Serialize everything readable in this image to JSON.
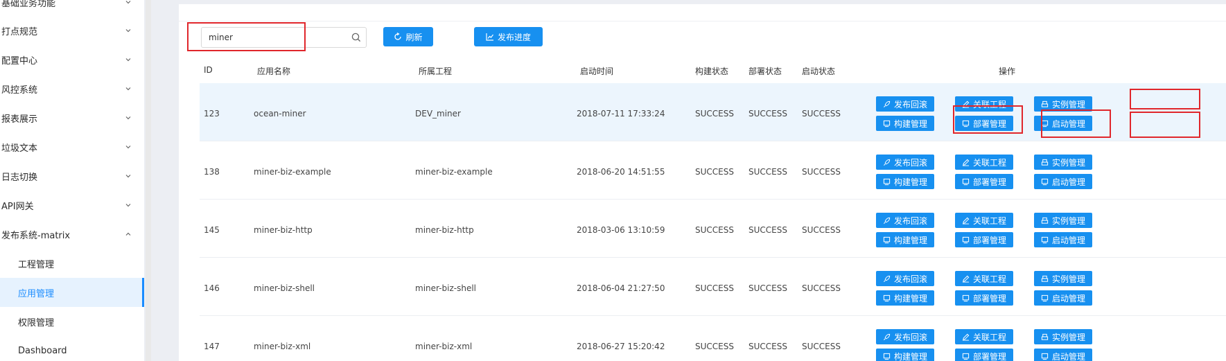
{
  "sidebar": {
    "menus": [
      {
        "label": "基础业务功能"
      },
      {
        "label": "打点规范"
      },
      {
        "label": "配置中心"
      },
      {
        "label": "风控系统"
      },
      {
        "label": "报表展示"
      },
      {
        "label": "垃圾文本"
      },
      {
        "label": "日志切换"
      },
      {
        "label": "API网关"
      },
      {
        "label": "发布系统-matrix"
      }
    ],
    "submenu": [
      {
        "label": "工程管理"
      },
      {
        "label": "应用管理",
        "active": true
      },
      {
        "label": "权限管理"
      },
      {
        "label": "Dashboard"
      }
    ]
  },
  "toolbar": {
    "search_value": "miner",
    "refresh_label": "刷新",
    "publish_progress_label": "发布进度"
  },
  "table": {
    "headers": {
      "id": "ID",
      "app_name": "应用名称",
      "project": "所属工程",
      "start_time": "启动时间",
      "build_status": "构建状态",
      "deploy_status": "部署状态",
      "start_status": "启动状态",
      "actions": "操作"
    },
    "action_labels": {
      "rollback": "发布回滚",
      "link_project": "关联工程",
      "instance_mgmt": "实例管理",
      "build_mgmt": "构建管理",
      "deploy_mgmt": "部署管理",
      "start_mgmt": "启动管理"
    },
    "rows": [
      {
        "id": "123",
        "app_name": "ocean-miner",
        "project": "DEV_miner",
        "start_time": "2018-07-11 17:33:24",
        "build_status": "SUCCESS",
        "deploy_status": "SUCCESS",
        "start_status": "SUCCESS"
      },
      {
        "id": "138",
        "app_name": "miner-biz-example",
        "project": "miner-biz-example",
        "start_time": "2018-06-20 14:51:55",
        "build_status": "SUCCESS",
        "deploy_status": "SUCCESS",
        "start_status": "SUCCESS"
      },
      {
        "id": "145",
        "app_name": "miner-biz-http",
        "project": "miner-biz-http",
        "start_time": "2018-03-06 13:10:59",
        "build_status": "SUCCESS",
        "deploy_status": "SUCCESS",
        "start_status": "SUCCESS"
      },
      {
        "id": "146",
        "app_name": "miner-biz-shell",
        "project": "miner-biz-shell",
        "start_time": "2018-06-04 21:27:50",
        "build_status": "SUCCESS",
        "deploy_status": "SUCCESS",
        "start_status": "SUCCESS"
      },
      {
        "id": "147",
        "app_name": "miner-biz-xml",
        "project": "miner-biz-xml",
        "start_time": "2018-06-27 15:20:42",
        "build_status": "SUCCESS",
        "deploy_status": "SUCCESS",
        "start_status": "SUCCESS"
      }
    ]
  },
  "colors": {
    "primary": "#1790f0",
    "highlight": "#e0262b",
    "active_menu_bg": "#e6f2fe"
  },
  "icons": [
    "chevron-down-icon",
    "chevron-up-icon",
    "search-icon",
    "refresh-icon",
    "chart-icon",
    "rocket-icon",
    "edit-icon",
    "monitor-icon",
    "printer-icon"
  ]
}
